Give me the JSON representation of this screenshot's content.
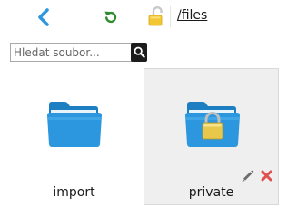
{
  "toolbar": {
    "back_icon": "chevron-left-icon",
    "refresh_icon": "refresh-icon",
    "lock_icon": "unlocked-padlock-icon",
    "path": "/files"
  },
  "search": {
    "placeholder": "Hledat soubor...",
    "value": "",
    "icon": "search-icon"
  },
  "folders": [
    {
      "name": "import",
      "icon": "folder-icon",
      "selected": false
    },
    {
      "name": "private",
      "icon": "locked-folder-icon",
      "selected": true
    }
  ],
  "tile_actions": {
    "edit_icon": "pencil-icon",
    "delete_icon": "delete-x-icon"
  },
  "colors": {
    "accent_blue": "#2c97de",
    "refresh_green": "#2e8b2e",
    "lock_yellow": "#f3c633",
    "delete_red": "#e05050",
    "selected_bg": "#efefef"
  }
}
